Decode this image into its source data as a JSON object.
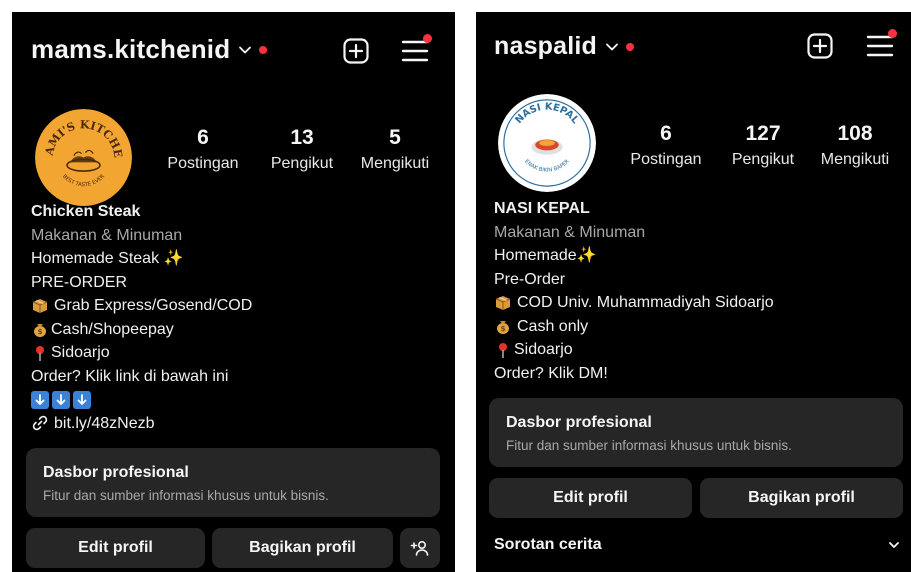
{
  "left": {
    "username": "mams.kitchenid",
    "avatar": {
      "brand_top": "MAMI'S KITCHEN",
      "brand_bottom": "BEST TASTE EVER",
      "bg": "#f3a532"
    },
    "stats": [
      {
        "value": "6",
        "label": "Postingan"
      },
      {
        "value": "13",
        "label": "Pengikut"
      },
      {
        "value": "5",
        "label": "Mengikuti"
      }
    ],
    "bio": {
      "name": "Chicken Steak",
      "category": "Makanan & Minuman",
      "line1": "Homemade Steak ✨",
      "line2": "PRE-ORDER",
      "line3": "Grab Express/Gosend/COD",
      "line4": "Cash/Shopeepay",
      "line5": "Sidoarjo",
      "line6": "Order? Klik link di bawah ini",
      "link": "bit.ly/48zNezb"
    },
    "dasbor": {
      "title": "Dasbor profesional",
      "subtitle": "Fitur dan sumber informasi khusus untuk bisnis."
    },
    "buttons": {
      "edit": "Edit profil",
      "share": "Bagikan profil"
    }
  },
  "right": {
    "username": "naspalid",
    "avatar": {
      "brand_top": "NASI KEPAL",
      "brand_bottom": "ENAK BIKIN BAPER",
      "bg": "#ffffff"
    },
    "stats": [
      {
        "value": "6",
        "label": "Postingan"
      },
      {
        "value": "127",
        "label": "Pengikut"
      },
      {
        "value": "108",
        "label": "Mengikuti"
      }
    ],
    "bio": {
      "name": "NASI KEPAL",
      "category": "Makanan & Minuman",
      "line1": "Homemade✨",
      "line2": "Pre-Order",
      "line3": "COD Univ. Muhammadiyah Sidoarjo",
      "line4": "Cash only",
      "line5": "Sidoarjo",
      "line6": "Order? Klik DM!"
    },
    "dasbor": {
      "title": "Dasbor profesional",
      "subtitle": "Fitur dan sumber informasi khusus untuk bisnis."
    },
    "buttons": {
      "edit": "Edit profil",
      "share": "Bagikan profil"
    },
    "highlights": {
      "title": "Sorotan cerita"
    }
  },
  "colors": {
    "background": "#000000",
    "card": "#262626",
    "notification": "#ff3040",
    "muted_text": "#a8a8a8",
    "arrow_emoji": "#3b82d6"
  },
  "icons": {
    "new_post": "plus-square-icon",
    "menu": "hamburger-menu-icon",
    "dropdown": "chevron-down-icon",
    "link": "link-icon",
    "add_person": "add-person-icon"
  }
}
